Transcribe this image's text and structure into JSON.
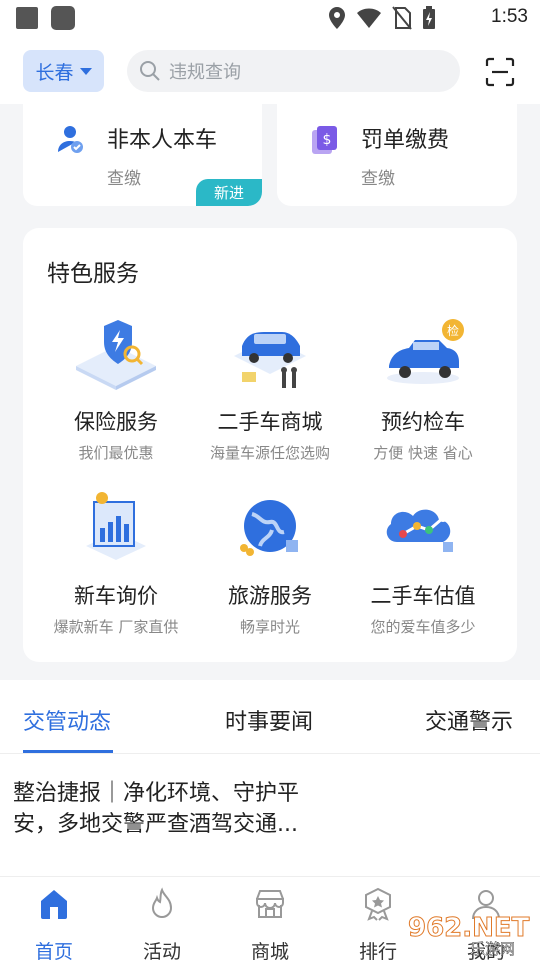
{
  "status_bar": {
    "time": "1:53"
  },
  "header": {
    "city": "长春",
    "search_placeholder": "违规查询"
  },
  "top_cards": [
    {
      "title": "非本人本车",
      "subtitle": "查缴",
      "badge": "新进"
    },
    {
      "title": "罚单缴费",
      "subtitle": "查缴"
    }
  ],
  "services": {
    "heading": "特色服务",
    "items": [
      {
        "name": "保险服务",
        "desc": "我们最优惠"
      },
      {
        "name": "二手车商城",
        "desc": "海量车源任您选购"
      },
      {
        "name": "预约检车",
        "desc": "方便 快速 省心"
      },
      {
        "name": "新车询价",
        "desc": "爆款新车 厂家直供"
      },
      {
        "name": "旅游服务",
        "desc": "畅享时光"
      },
      {
        "name": "二手车估值",
        "desc": "您的爱车值多少"
      }
    ],
    "inspection_badge": "检"
  },
  "news": {
    "tabs": [
      "交管动态",
      "时事要闻",
      "交通警示"
    ],
    "headline": "整治捷报｜净化环境、守护平安，多地交警严查酒驾交通..."
  },
  "bottom_nav": [
    "首页",
    "活动",
    "商城",
    "排行",
    "我的"
  ],
  "watermark": {
    "text": "962.NET",
    "sub": "乐游网"
  },
  "colors": {
    "accent": "#2f6fde",
    "badge": "#2bb8c7",
    "purple": "#7a5ae6"
  }
}
